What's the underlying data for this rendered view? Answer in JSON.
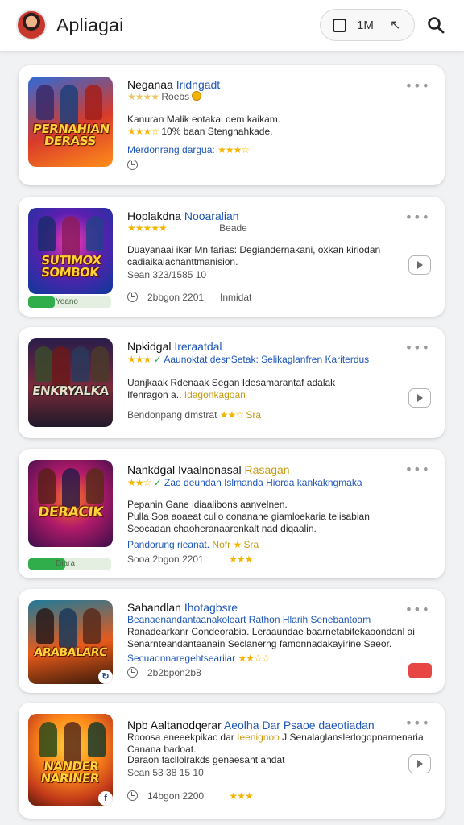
{
  "header": {
    "title": "Apliagai",
    "toolbar_text": "1M",
    "toolbar_arrow": "↖"
  },
  "colors": {
    "accent_blue": "#1f57b8",
    "star": "#f5b400",
    "progress_green": "#2fae4b",
    "alert_red": "#e84545"
  },
  "icons": [
    "avatar",
    "square-icon",
    "arrow-icon",
    "search-icon",
    "more-icon",
    "play-icon",
    "clock-icon",
    "check-icon",
    "coin-icon"
  ],
  "cards": [
    {
      "thumb_logo": "PERNAHIAN DERASS",
      "name": "Neganaa",
      "name_accent": "Iridngadt",
      "rating_label": "Roebs",
      "line1": "Kanuran Malik eotakai dem kaikam.",
      "line2_stars": "★★★☆",
      "line2": "10% baan Stengnahkade.",
      "line3": "Merdonrang dargua:",
      "line3_stars": "★★★☆"
    },
    {
      "thumb_logo": "SUTIMOX SOMBOK",
      "name": "Hoplakdna",
      "name_accent": "Nooaralian",
      "rating_label": "Beade",
      "line1": "Duayanaai ikar Mn farias: Degiandernakani, oxkan kiriodan",
      "line2": "cadiaikalachanttmanision.",
      "line3": "Sean 323/1585 10",
      "progress": 0.32,
      "progress_label": "Yeano",
      "footer": "2bbgon 2201",
      "footer2": "Inmidat"
    },
    {
      "thumb_logo": "ENKRYALKA",
      "name": "Npkidgal",
      "name_accent": "Ireraatdal",
      "rating_stars": "★★★",
      "verified_text": "Aaunoktat desnSetak: Selikaglanfren Kariterdus",
      "line1": "Uanjkaak Rdenaak Segan Idesamarantaf adalak",
      "line2": "Ifenragon a..",
      "line2_accent": "Idagonkagoan",
      "line3": "Bendonpang dmstrat",
      "line3_stars": "★★☆",
      "line3_label": "Sra"
    },
    {
      "thumb_logo": "DERACIK",
      "name": "Nankdgal Ivaalnonasal",
      "name_accent": "Rasagan",
      "rating_stars": "★★☆",
      "verified_text": "Zao deundan Islmanda Hiorda kankakngmaka",
      "line1": "Pepanin Gane idiaalibons aanvelnen.",
      "line2": "Pulla Soa aoaeat cullo conanane giamloekaria telisabian",
      "line3": "Seocadan chaoheranaarenkalt nad diqaalin.",
      "line4": "Pandorung rieanat.",
      "line4_accent": "Nofr",
      "line4_stars": "★",
      "line4_label": "Sra",
      "progress": 0.45,
      "progress_label": "Diara",
      "footer": "Sooa 2bgon 2201",
      "footer_stars": "★★★"
    },
    {
      "thumb_logo": "ARABALARC",
      "name": "Sahandlan",
      "name_accent": "Ihotagbsre",
      "line1": "Beanaenandantaanakoleart Rathon Hlarih Senebantoam",
      "line2": "Ranadearkanr Condeorabia. Leraaundae baarnetabitekaoondanl ai",
      "line3": "Senarnteandanteanain Seclanerng famonnadakayirine Saeor.",
      "footer": "Secuaonnaregehtseariiar",
      "footer_stars": "★★☆☆",
      "footer2": "2b2bpon2b8"
    },
    {
      "thumb_logo": "NANDER NARINER",
      "name": "Npb Aaltanodqerar",
      "name_accent": "Aeolha Dar Psaoe daeotiadan",
      "line1": "Rooosa eneeekpikac dar",
      "line1_accent": "Ieenignoo",
      "line1b": "J  Senalaglanslerlogopnarnenaria",
      "line2": "Canana badoat.",
      "line3": "Daraon facllolrakds genaesant andat",
      "line4": "Sean 53 38 15 10",
      "footer": "14bgon 2200",
      "footer_stars": "★★★"
    }
  ]
}
